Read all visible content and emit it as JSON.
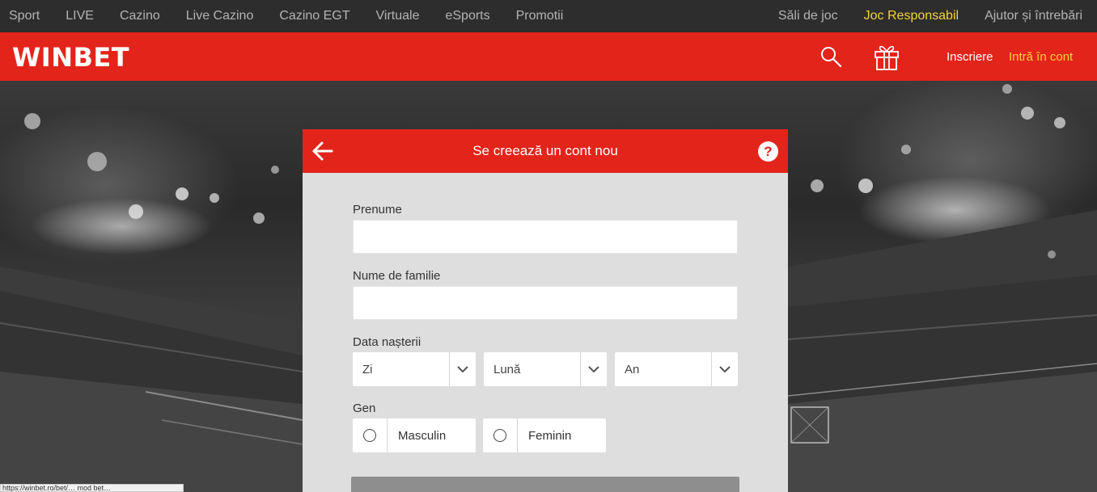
{
  "topnav": {
    "left_items": [
      "Sport",
      "LIVE",
      "Cazino",
      "Live Cazino",
      "Cazino EGT",
      "Virtuale",
      "eSports",
      "Promotii"
    ],
    "right_items": [
      "Săli de joc",
      "Joc Responsabil",
      "Ajutor și întrebări"
    ]
  },
  "header": {
    "logo": "WINBET",
    "register_label": "Inscriere",
    "login_label": "Intră în cont"
  },
  "form": {
    "title": "Se creează un cont nou",
    "help": "?",
    "first_name_label": "Prenume",
    "first_name_value": "",
    "last_name_label": "Nume de familie",
    "last_name_value": "",
    "dob_label": "Data nașterii",
    "day_selected": "Zi",
    "month_selected": "Lună",
    "year_selected": "An",
    "gender_label": "Gen",
    "gender_male": "Masculin",
    "gender_female": "Feminin"
  },
  "statusbar": {
    "url": "https://winbet.ro/bet/… mod bet…"
  },
  "colors": {
    "brand_red": "#e3241b",
    "highlight_yellow": "#f5d33a",
    "nav_bg": "#2d2d2d",
    "card_bg": "#dedede"
  }
}
